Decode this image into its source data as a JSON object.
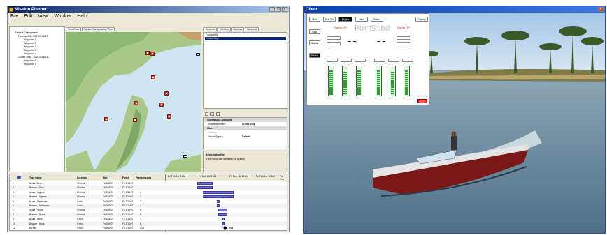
{
  "mission_planner": {
    "title": "Mission Planner",
    "window_controls": [
      "_",
      "□",
      "×"
    ],
    "menu": [
      "File",
      "Edit",
      "View",
      "Window",
      "Help"
    ],
    "tree": [
      "Default Deployment",
      "Fountain58 - 2007/2/16/17",
      "Waypoint 0",
      "Waypoint 1",
      "Waypoint 2",
      "Waypoint 3",
      "Waypoint 4",
      "Cruise Ship - 2007/2/16/15",
      "Waypoint 0",
      "Waypoint 1"
    ],
    "center_tabs": [
      "WorldView",
      "System Configuration View"
    ],
    "right_tabs": [
      "Systems",
      "Vehicles",
      "Sensors",
      "Weapons"
    ],
    "systems_list": [
      "Fountain58",
      "Cruise Ship"
    ],
    "properties": {
      "section1": "Appearance Attributes",
      "rows1": [
        {
          "k": "SystemIdentifier",
          "v": "Cruise Ship"
        }
      ],
      "section2": "Misc",
      "rows2": [
        {
          "k": "Velocity",
          "v": ""
        },
        {
          "k": "VehicleType",
          "v": "Default"
        }
      ],
      "help_title": "SystemIdentifier",
      "help_text": "A text string that identifies the system."
    },
    "gantt": {
      "columns": [
        "Task Name",
        "Duration",
        "Start",
        "Finish",
        "Predecessors"
      ],
      "timeline_headers": [
        "Fri Feb 16, 8 AM",
        "Fri Feb 16, 9 AM",
        "Fri Feb 16, 10 AM",
        "Fri Feb 16, 11 AM",
        "Fri Feb 16"
      ],
      "rows": [
        {
          "id": "1",
          "name": "Acura - Drop",
          "dur": "30 mins",
          "start": "Fri 2/16/07",
          "finish": "Fri 2/16/07",
          "pred": ""
        },
        {
          "id": "2",
          "name": "Beamer - Drop",
          "dur": "30 mins",
          "start": "Fri 2/16/07",
          "finish": "Fri 2/16/07",
          "pred": ""
        },
        {
          "id": "3",
          "name": "Acura - Ingress",
          "dur": "60 mins",
          "start": "Fri 2/16/07",
          "finish": "Fri 2/16/07",
          "pred": "1"
        },
        {
          "id": "4",
          "name": "Beamer - Ingress",
          "dur": "60 mins",
          "start": "Fri 2/16/07",
          "finish": "Fri 2/16/07",
          "pred": "2"
        },
        {
          "id": "5",
          "name": "Acura - Maneuver",
          "dur": "2 mins",
          "start": "Fri 2/16/07",
          "finish": "Fri 2/16/07",
          "pred": "3"
        },
        {
          "id": "6",
          "name": "Beamer - Maneuver",
          "dur": "2 mins",
          "start": "Fri 2/16/07",
          "finish": "Fri 2/16/07",
          "pred": "4"
        },
        {
          "id": "7",
          "name": "Acura - Sprint",
          "dur": "20 mins",
          "start": "Fri 2/16/07",
          "finish": "Fri 2/16/07",
          "pred": "5"
        },
        {
          "id": "8",
          "name": "Beamer - Sprint",
          "dur": "20 mins",
          "start": "Fri 2/16/07",
          "finish": "Fri 2/16/07",
          "pred": "6"
        },
        {
          "id": "9",
          "name": "Acura - Hook",
          "dur": "5 mins",
          "start": "Fri 2/16/07",
          "finish": "Fri 2/16/07",
          "pred": "7"
        },
        {
          "id": "10",
          "name": "Beamer - Hook",
          "dur": "5 mins",
          "start": "Fri 2/16/07",
          "finish": "Fri 2/16/07",
          "pred": "8"
        },
        {
          "id": "11",
          "name": "H-Hour",
          "dur": "0 mins",
          "start": "Fri 2/16/07",
          "finish": "Fri 2/16/07",
          "pred": "10,9"
        }
      ],
      "milestone_label": "2/16"
    }
  },
  "client": {
    "title": "Client",
    "top_buttons": [
      "Main",
      "Sub-Ctrl",
      "Engine",
      "Helm",
      "Status"
    ],
    "right_button": "Display",
    "left_buttons": [
      "Page",
      "Alarms",
      "Ballast"
    ],
    "engine_labels": [
      "Engines OFF",
      "Engines OFF"
    ],
    "port_label": "Port",
    "stbd_label": "Stbd",
    "dashes": "– –",
    "stop_label": "STOP"
  }
}
